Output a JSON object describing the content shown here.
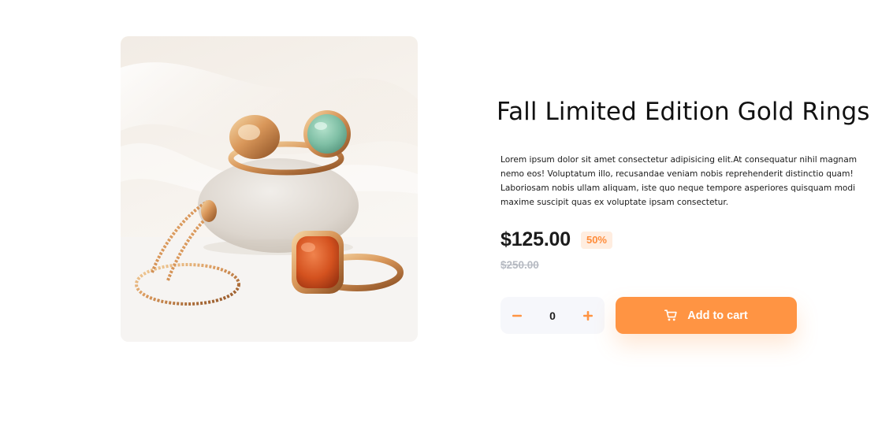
{
  "product": {
    "title": "Fall Limited Edition Gold Rings",
    "description": "Lorem ipsum dolor sit amet consectetur adipisicing elit.At consequatur nihil magnam nemo eos! Voluptatum illo, recusandae veniam nobis reprehenderit distinctio quam! Laboriosam nobis ullam aliquam, iste quo neque tempore asperiores quisquam modi maxime suscipit quas ex voluptate ipsam consectetur.",
    "price": "$125.00",
    "discount": "50%",
    "old_price": "$250.00"
  },
  "cart": {
    "quantity": "0",
    "add_label": "Add to cart"
  },
  "icons": {
    "minus": "minus-icon",
    "plus": "plus-icon",
    "cart": "cart-icon"
  },
  "colors": {
    "accent": "#ff9443",
    "badge_bg": "#ffede0",
    "badge_text": "#ff8c3a",
    "old_price": "#b6bac2",
    "qty_bg": "#f6f7fb"
  }
}
